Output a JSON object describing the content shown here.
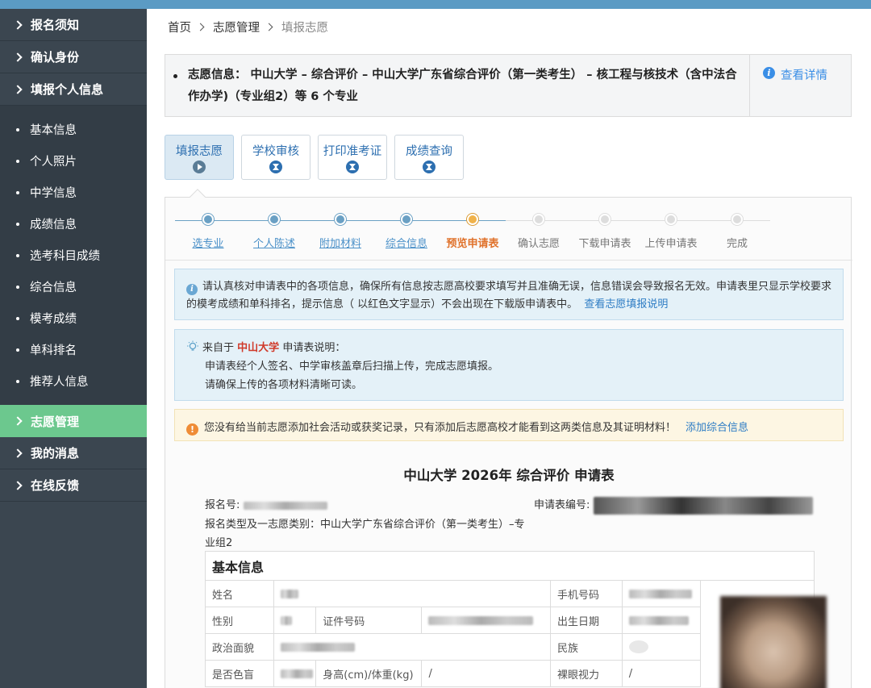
{
  "sidebar": {
    "top_items": [
      "报名须知",
      "确认身份",
      "填报个人信息"
    ],
    "sub_items": [
      "基本信息",
      "个人照片",
      "中学信息",
      "成绩信息",
      "选考科目成绩",
      "综合信息",
      "模考成绩",
      "单科排名",
      "推荐人信息"
    ],
    "bottom_items": [
      "志愿管理",
      "我的消息",
      "在线反馈"
    ]
  },
  "breadcrumb": {
    "home": "首页",
    "section": "志愿管理",
    "current": "填报志愿"
  },
  "info": {
    "text": "志愿信息： 中山大学 – 综合评价 – 中山大学广东省综合评价（第一类考生） – 核工程与核技术（含中法合作办学)（专业组2）等 6 个专业",
    "detail_link": "查看详情"
  },
  "tabs": [
    {
      "label": "填报志愿",
      "icon": "play-icon"
    },
    {
      "label": "学校审核",
      "icon": "hourglass-icon"
    },
    {
      "label": "打印准考证",
      "icon": "hourglass-icon"
    },
    {
      "label": "成绩查询",
      "icon": "hourglass-icon"
    }
  ],
  "steps": [
    {
      "label": "选专业",
      "state": "done"
    },
    {
      "label": "个人陈述",
      "state": "done"
    },
    {
      "label": "附加材料",
      "state": "done"
    },
    {
      "label": "综合信息",
      "state": "done"
    },
    {
      "label": "预览申请表",
      "state": "current"
    },
    {
      "label": "确认志愿",
      "state": "todo"
    },
    {
      "label": "下载申请表",
      "state": "todo"
    },
    {
      "label": "上传申请表",
      "state": "todo"
    },
    {
      "label": "完成",
      "state": "todo"
    }
  ],
  "notice1": {
    "text": "请认真核对申请表中的各项信息，确保所有信息按志愿高校要求填写并且准确无误，信息错误会导致报名无效。申请表里只显示学校要求的模考成绩和单科排名，提示信息（ 以红色文字显示）不会出现在下载版申请表中。",
    "link": "查看志愿填报说明"
  },
  "notice2": {
    "prefix": "来自于",
    "university": "中山大学",
    "suffix": "申请表说明：",
    "line1": "申请表经个人签名、中学审核盖章后扫描上传，完成志愿填报。",
    "line2": "请确保上传的各项材料清晰可读。"
  },
  "warning": {
    "text": "您没有给当前志愿添加社会活动或获奖记录，只有添加后志愿高校才能看到这两类信息及其证明材料！",
    "link": "添加综合信息"
  },
  "form": {
    "title": "中山大学 2026年 综合评价 申请表",
    "reg_no_label": "报名号:",
    "app_no_label": "申请表编号:",
    "type_line1": "报名类型及一志愿类别：中山大学广东省综合评价（第一类考生）–专",
    "type_line2": "业组2",
    "section": "基本信息",
    "labels": {
      "name": "姓名",
      "phone": "手机号码",
      "gender": "性别",
      "id_no": "证件号码",
      "birth": "出生日期",
      "politics": "政治面貌",
      "ethnic": "民族",
      "colorblind": "是否色盲",
      "height_weight": "身高(cm)/体重(kg)",
      "height_weight_value": "/",
      "vision": "裸眼视力",
      "vision_value": "/"
    }
  }
}
